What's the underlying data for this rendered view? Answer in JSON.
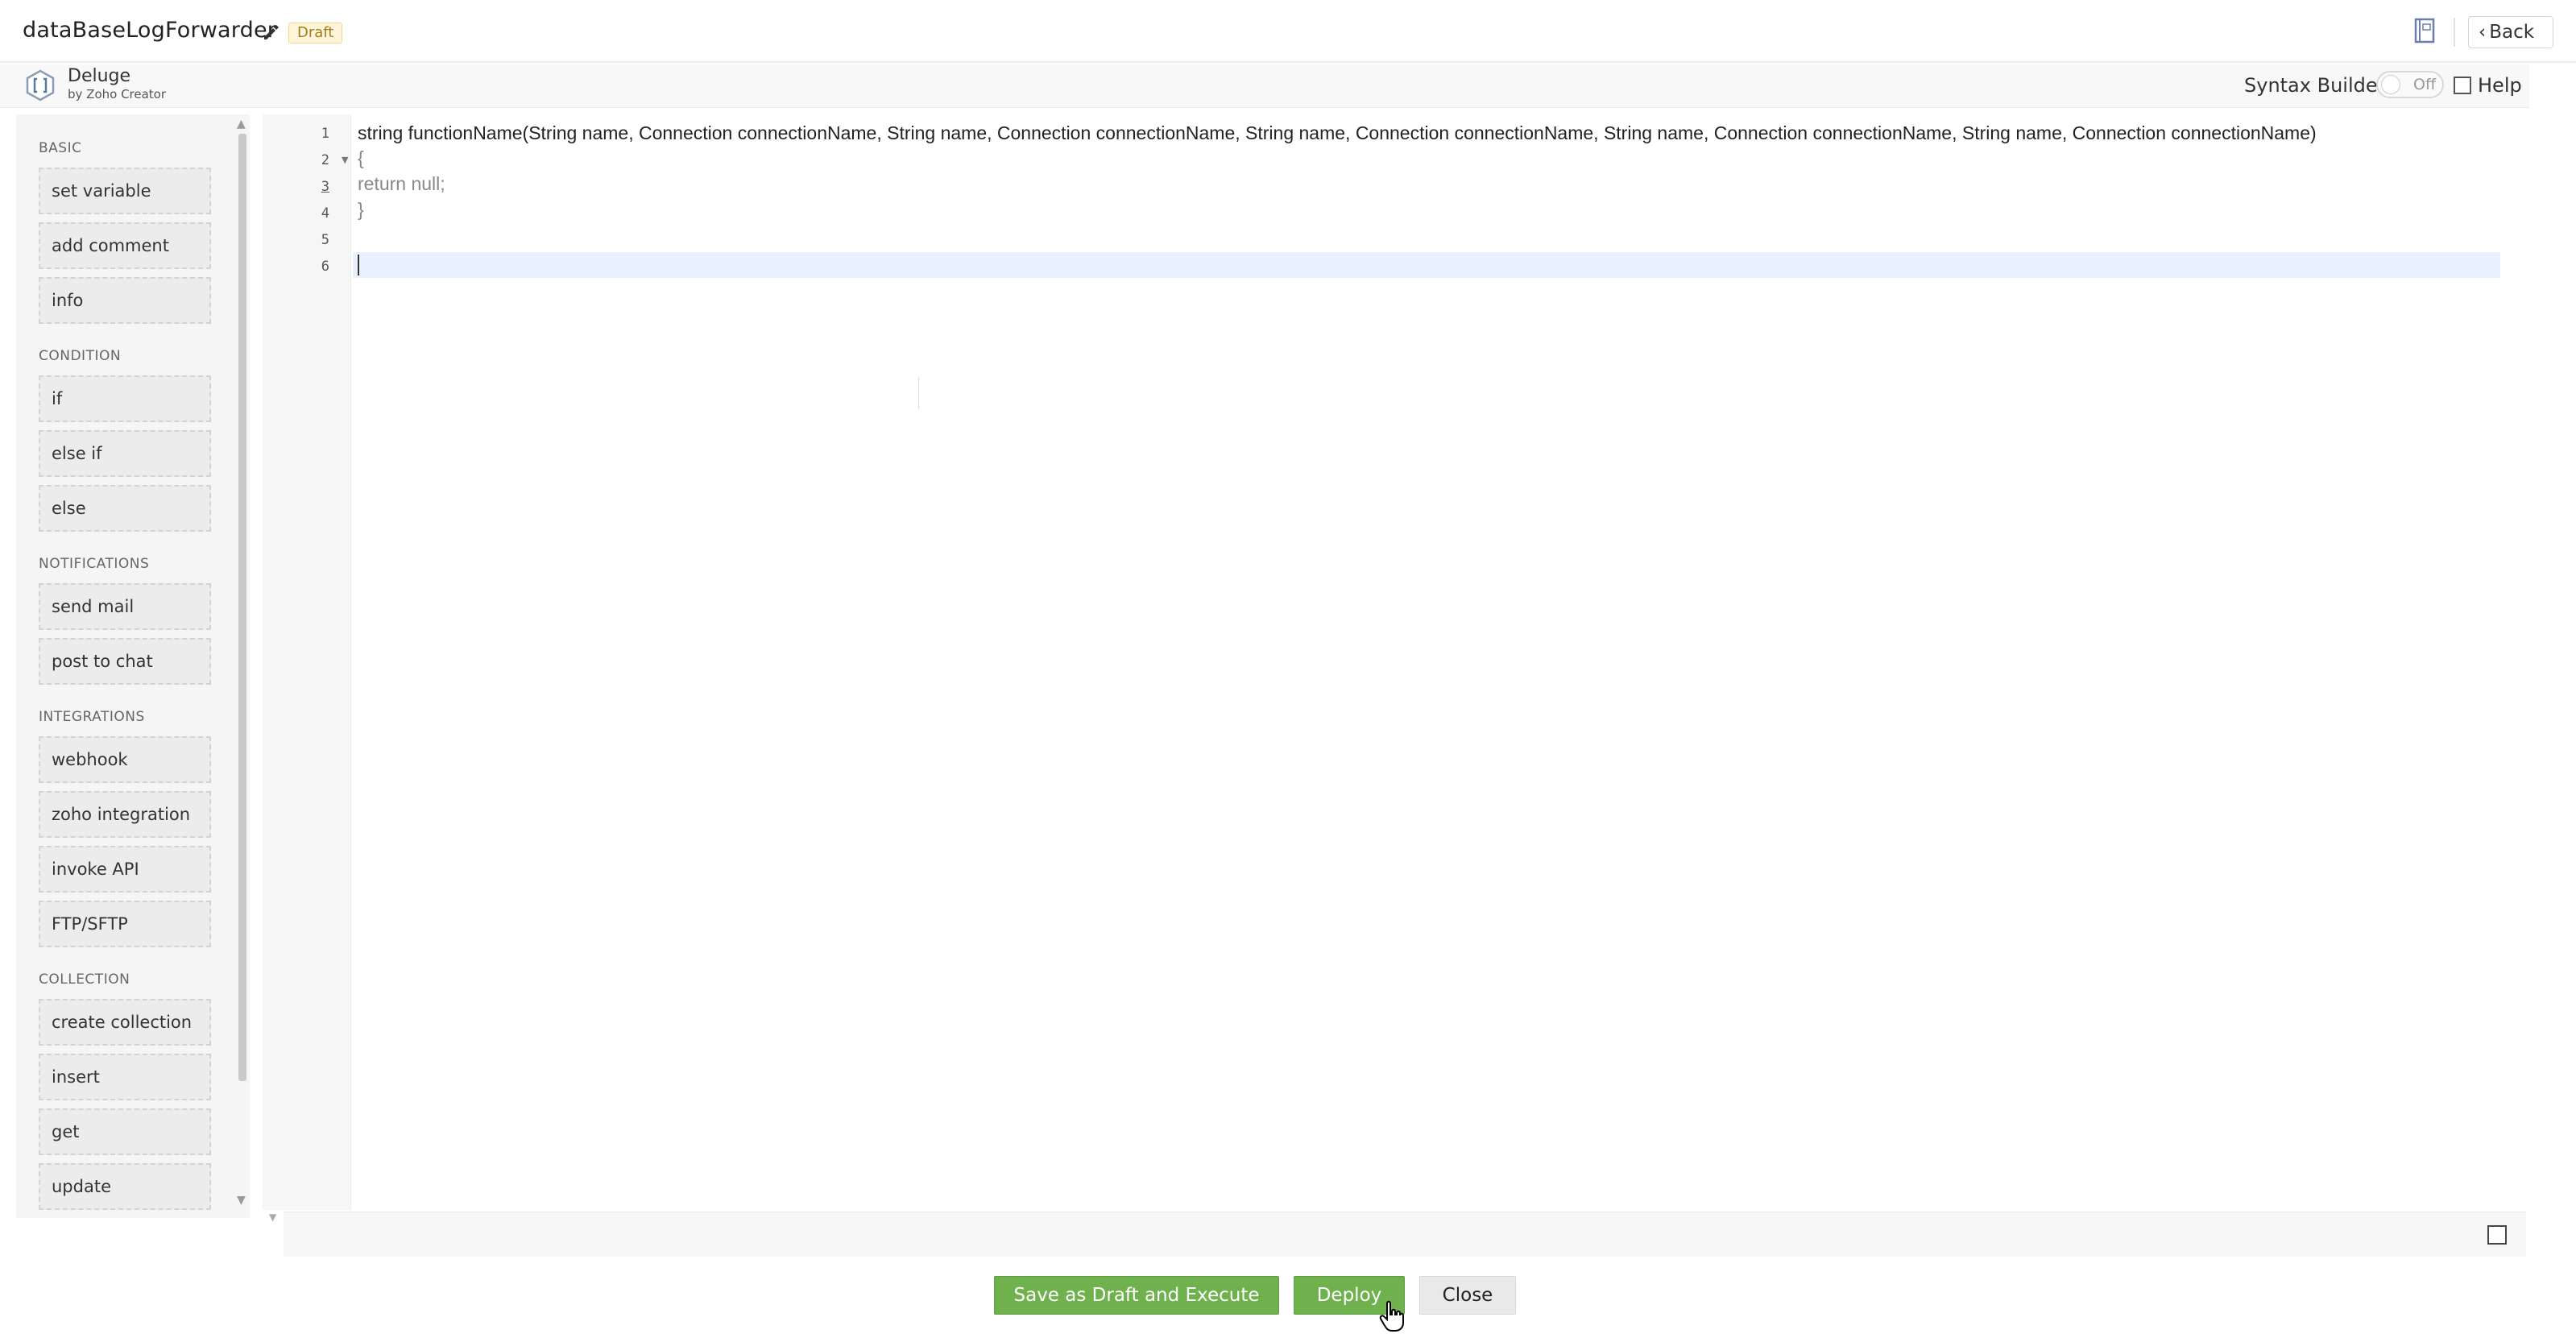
{
  "header": {
    "title": "dataBaseLogForwarder",
    "badge": "Draft",
    "back_label": "Back"
  },
  "deluge": {
    "name": "Deluge",
    "subtitle": "by Zoho Creator",
    "syntax_builder_label": "Syntax Builder",
    "toggle_state": "Off",
    "help_label": "Help"
  },
  "sidebar": {
    "sections": [
      {
        "label": "BASIC",
        "items": [
          "set variable",
          "add comment",
          "info"
        ]
      },
      {
        "label": "CONDITION",
        "items": [
          "if",
          "else if",
          "else"
        ]
      },
      {
        "label": "NOTIFICATIONS",
        "items": [
          "send mail",
          "post to chat"
        ]
      },
      {
        "label": "INTEGRATIONS",
        "items": [
          "webhook",
          "zoho integration",
          "invoke API",
          "FTP/SFTP"
        ]
      },
      {
        "label": "COLLECTION",
        "items": [
          "create collection",
          "insert",
          "get",
          "update"
        ]
      }
    ]
  },
  "editor": {
    "line_numbers": [
      "1",
      "2",
      "3",
      "4",
      "5",
      "6"
    ],
    "lines": [
      "string functionName(String name, Connection connectionName, String name, Connection connectionName, String name, Connection connectionName, String name, Connection connectionName, String name, Connection connectionName)",
      "{",
      "return null;",
      "}",
      "",
      ""
    ]
  },
  "actions": {
    "save_draft_label": "Save as Draft and Execute",
    "deploy_label": "Deploy",
    "close_label": "Close"
  },
  "colors": {
    "primary_green": "#6fb14d",
    "active_line": "#e8f1fd",
    "draft_badge_text": "#a07c1c"
  }
}
